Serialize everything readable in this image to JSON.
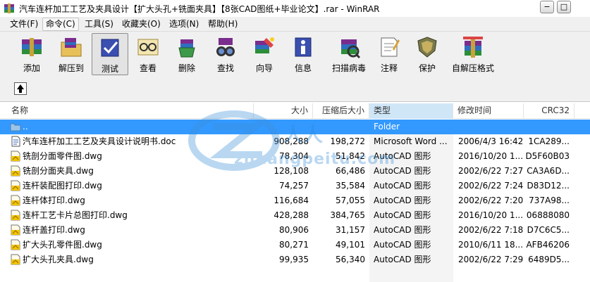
{
  "window": {
    "title": "汽车连杆加工工艺及夹具设计【扩大头孔+铣面夹具】【8张CAD图纸+毕业论文】.rar - WinRAR",
    "minimize_label": "−",
    "restore_label": "□"
  },
  "menu": [
    {
      "label": "文件(F)"
    },
    {
      "label": "命令(C)"
    },
    {
      "label": "工具(S)"
    },
    {
      "label": "收藏夹(O)"
    },
    {
      "label": "选项(N)"
    },
    {
      "label": "帮助(H)"
    }
  ],
  "toolbar": [
    {
      "label": "添加",
      "icon": "add-books-icon"
    },
    {
      "label": "解压到",
      "icon": "extract-folder-icon"
    },
    {
      "label": "测试",
      "icon": "test-check-icon"
    },
    {
      "label": "查看",
      "icon": "view-glasses-icon"
    },
    {
      "label": "删除",
      "icon": "delete-recycle-icon"
    },
    {
      "label": "查找",
      "icon": "find-binoculars-icon"
    },
    {
      "label": "向导",
      "icon": "wizard-icon"
    },
    {
      "label": "信息",
      "icon": "info-icon"
    },
    {
      "label": "扫描病毒",
      "icon": "virus-scan-icon"
    },
    {
      "label": "注释",
      "icon": "comment-icon"
    },
    {
      "label": "保护",
      "icon": "protect-shield-icon"
    },
    {
      "label": "自解压格式",
      "icon": "sfx-icon"
    }
  ],
  "columns": {
    "name": "名称",
    "size": "大小",
    "packed": "压缩后大小",
    "type": "类型",
    "modified": "修改时间",
    "crc": "CRC32"
  },
  "files": [
    {
      "name": "..",
      "size": "",
      "packed": "",
      "type": "Folder",
      "modified": "",
      "crc": "",
      "icon": "folder-up-icon"
    },
    {
      "name": "汽车连杆加工工艺及夹具设计说明书.doc",
      "size": "908,288",
      "packed": "198,272",
      "type": "Microsoft Word ...",
      "modified": "2006/4/3 16:42",
      "crc": "1CA289...",
      "icon": "word-doc-icon"
    },
    {
      "name": "铣剖分面零件图.dwg",
      "size": "78,304",
      "packed": "51,842",
      "type": "AutoCAD 图形",
      "modified": "2016/10/20 1...",
      "crc": "D5F60B03",
      "icon": "dwg-file-icon"
    },
    {
      "name": "铣剖分面夹具.dwg",
      "size": "128,108",
      "packed": "66,486",
      "type": "AutoCAD 图形",
      "modified": "2002/6/22 7:27",
      "crc": "CA3A6D...",
      "icon": "dwg-file-icon"
    },
    {
      "name": "连杆装配图打印.dwg",
      "size": "74,257",
      "packed": "35,584",
      "type": "AutoCAD 图形",
      "modified": "2002/6/22 7:24",
      "crc": "D83D12...",
      "icon": "dwg-file-icon"
    },
    {
      "name": "连杆体打印.dwg",
      "size": "116,684",
      "packed": "57,055",
      "type": "AutoCAD 图形",
      "modified": "2002/6/22 7:20",
      "crc": "737A98...",
      "icon": "dwg-file-icon"
    },
    {
      "name": "连杆工艺卡片总图打印.dwg",
      "size": "428,288",
      "packed": "384,765",
      "type": "AutoCAD 图形",
      "modified": "2016/10/20 1...",
      "crc": "06888080",
      "icon": "dwg-file-icon"
    },
    {
      "name": "连杆盖打印.dwg",
      "size": "80,906",
      "packed": "31,157",
      "type": "AutoCAD 图形",
      "modified": "2002/6/22 7:18",
      "crc": "D7C6C5...",
      "icon": "dwg-file-icon"
    },
    {
      "name": "扩大头孔零件图.dwg",
      "size": "80,271",
      "packed": "49,101",
      "type": "AutoCAD 图形",
      "modified": "2010/6/11 18...",
      "crc": "AFB46206",
      "icon": "dwg-file-icon"
    },
    {
      "name": "扩大头孔夹具.dwg",
      "size": "99,935",
      "packed": "56,340",
      "type": "AutoCAD 图形",
      "modified": "2002/6/22 7:29",
      "crc": "6489D5...",
      "icon": "dwg-file-icon"
    }
  ],
  "watermark": {
    "cn": "人人",
    "text": "zhuangpeitu.com"
  }
}
